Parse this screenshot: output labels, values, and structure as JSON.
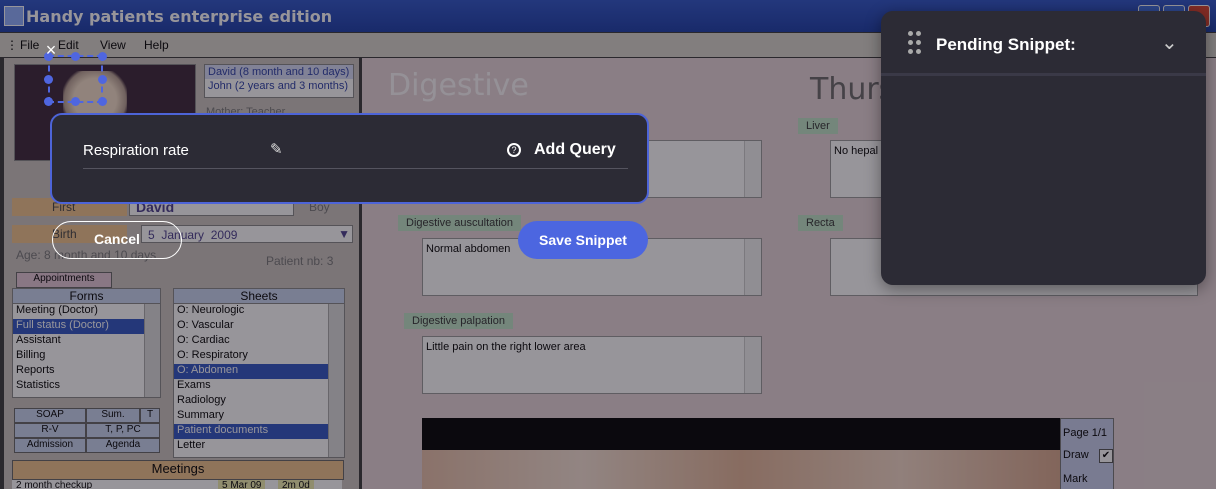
{
  "window": {
    "title": "Handy patients enterprise edition"
  },
  "menu": {
    "items": [
      "File",
      "Edit",
      "View",
      "Help"
    ]
  },
  "patients": {
    "list": [
      "David  (8 month and 10 days)",
      "John  (2 years and 3 months)"
    ],
    "mother": "Mother: Teacher",
    "first_label": "First",
    "first_value": "David",
    "sex": "Boy",
    "birth_label": "Birth",
    "birth_day": "5",
    "birth_month": "January",
    "birth_year": "2009",
    "age": "Age: 8 month and 10 days",
    "patient_nb": "Patient nb: 3"
  },
  "appointments_label": "Appointments",
  "forms": {
    "header": "Forms",
    "items": [
      "Meeting (Doctor)",
      "Full status (Doctor)",
      "Assistant",
      "Billing",
      "Reports",
      "Statistics"
    ]
  },
  "sheets": {
    "header": "Sheets",
    "items": [
      "O: Neurologic",
      "O: Vascular",
      "O: Cardiac",
      "O: Respiratory",
      "O: Abdomen",
      "Exams",
      "Radiology",
      "Summary",
      "Patient documents",
      "Letter"
    ]
  },
  "buttons": {
    "soap": "SOAP",
    "sum": "Sum.",
    "t": "T",
    "rv": "R-V",
    "tppc": "T, P, PC",
    "admission": "Admission",
    "agenda": "Agenda"
  },
  "meetings": {
    "header": "Meetings",
    "row_name": "2 month checkup",
    "row_date": "5 Mar 09",
    "row_age": "2m 0d"
  },
  "main": {
    "section_title": "Digestive",
    "date_title": "Thurs",
    "liver_label": "Liver",
    "liver_text": "No hepal",
    "rectal_label": "Recta",
    "ausc_label": "Digestive auscultation",
    "ausc_text": "Normal abdomen",
    "palp_label": "Digestive palpation",
    "palp_text": "Little pain on the right lower area"
  },
  "viewer": {
    "page": "Page 1/1",
    "draw": "Draw",
    "mark": "Mark"
  },
  "snippet": {
    "field_name": "Respiration rate",
    "add_query": "Add Query",
    "cancel": "Cancel",
    "save": "Save Snippet",
    "close": "×"
  },
  "pending": {
    "title": "Pending Snippet:"
  }
}
